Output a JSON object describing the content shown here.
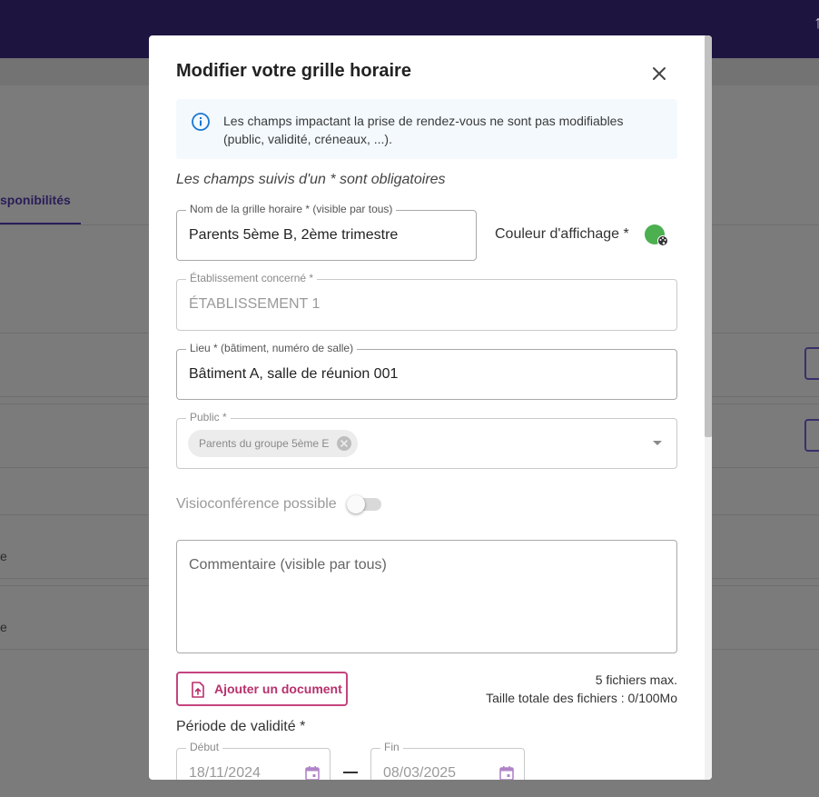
{
  "background": {
    "tab_label": "sponibilités",
    "row_letter_1": "e",
    "row_letter_2": "e"
  },
  "modal": {
    "title": "Modifier votre grille horaire",
    "info_text": "Les champs impactant la prise de rendez-vous ne sont pas modifiables (public, validité, créneaux, ...).",
    "required_note": "Les champs suivis d'un * sont obligatoires",
    "name_field": {
      "label": "Nom de la grille horaire * (visible par tous)",
      "value": "Parents 5ème B, 2ème trimestre"
    },
    "color_label": "Couleur d'affichage *",
    "color_value": "#4caf50",
    "establishment_field": {
      "label": "Établissement concerné *",
      "value": "ÉTABLISSEMENT 1"
    },
    "location_field": {
      "label": "Lieu * (bâtiment, numéro de salle)",
      "value": "Bâtiment A, salle de réunion 001"
    },
    "public_field": {
      "label": "Public *",
      "chip": "Parents du groupe 5ème E"
    },
    "visio_label": "Visioconférence possible",
    "visio_enabled": false,
    "comment_placeholder": "Commentaire (visible par tous)",
    "add_document_label": "Ajouter un document",
    "files_max": "5 fichiers max.",
    "files_size": "Taille totale des fichiers : 0/100Mo",
    "period_label": "Période de validité *",
    "start_field": {
      "label": "Début",
      "value": "18/11/2024"
    },
    "end_field": {
      "label": "Fin",
      "value": "08/03/2025"
    }
  },
  "colors": {
    "primary_dark": "#1e1440",
    "accent_pink": "#c4447e",
    "info_blue": "#1976d2"
  }
}
